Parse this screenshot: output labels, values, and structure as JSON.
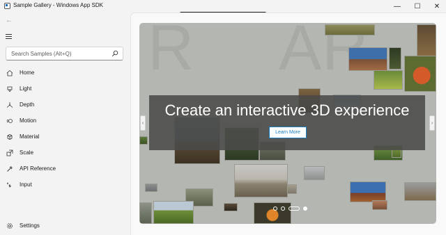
{
  "window": {
    "title": "Sample Gallery - Windows App SDK",
    "minimize_glyph": "—",
    "maximize_glyph": "☐",
    "close_glyph": "✕"
  },
  "debug_toolbar": {
    "icons": [
      "select-element-icon",
      "video-icon",
      "cursor-icon",
      "frame-icon",
      "layout-icon",
      "hot-reload-icon",
      "check-icon"
    ],
    "chevron": "‹"
  },
  "sidebar": {
    "back_glyph": "←",
    "search_placeholder": "Search Samples (Alt+Q)",
    "items": [
      {
        "label": "Home",
        "icon": "home-icon"
      },
      {
        "label": "Light",
        "icon": "light-icon"
      },
      {
        "label": "Depth",
        "icon": "depth-icon"
      },
      {
        "label": "Motion",
        "icon": "motion-icon"
      },
      {
        "label": "Material",
        "icon": "material-icon"
      },
      {
        "label": "Scale",
        "icon": "scale-icon"
      },
      {
        "label": "API Reference",
        "icon": "api-reference-icon"
      },
      {
        "label": "Input",
        "icon": "input-icon"
      }
    ],
    "settings_label": "Settings"
  },
  "hero": {
    "title": "Create an interactive 3D experience",
    "button_label": "Learn More",
    "prev_glyph": "‹",
    "next_glyph": "›",
    "background_letters": [
      "R",
      "A",
      "R"
    ],
    "page_count": 4,
    "active_page": 2
  },
  "colors": {
    "accent": "#1a7fc1",
    "hero_bg": "#b4b7b1",
    "banner_bg": "#4a4a48",
    "debug_bar": "#202020",
    "check_green": "#3fb950"
  }
}
